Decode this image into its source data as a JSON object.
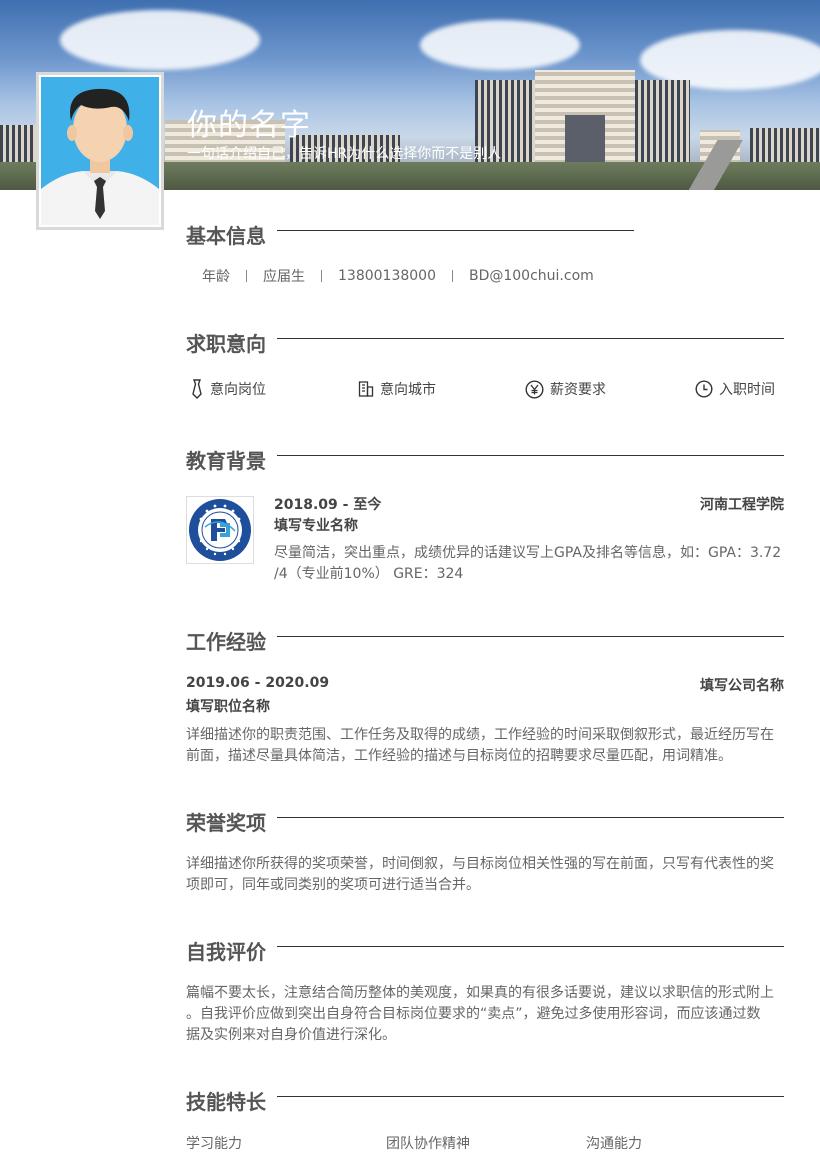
{
  "header": {
    "name": "你的名字",
    "tagline": "一句话介绍自己，告诉HR为什么选择你而不是别人"
  },
  "basic": {
    "title": "基本信息",
    "items": [
      "年龄",
      "应届生",
      "13800138000",
      "BD@100chui.com"
    ]
  },
  "intent": {
    "title": "求职意向",
    "items": [
      {
        "label": "意向岗位",
        "icon": "tie-icon"
      },
      {
        "label": "意向城市",
        "icon": "building-icon"
      },
      {
        "label": "薪资要求",
        "icon": "yen-icon"
      },
      {
        "label": "入职时间",
        "icon": "clock-icon"
      }
    ]
  },
  "education": {
    "title": "教育背景",
    "date": "2018.09 - 至今",
    "school": "河南工程学院",
    "major": "填写专业名称",
    "desc": "尽量简洁，突出重点，成绩优异的话建议写上GPA及排名等信息，如：GPA：3.72",
    "desc2": "/4（专业前10%） GRE：324"
  },
  "work": {
    "title": "工作经验",
    "date": "2019.06 - 2020.09",
    "company": "填写公司名称",
    "position": "填写职位名称",
    "desc1": "详细描述你的职责范围、工作任务及取得的成绩，工作经验的时间采取倒叙形式，最近经历写在",
    "desc2": "前面，描述尽量具体简洁，工作经验的描述与目标岗位的招聘要求尽量匹配，用词精准。"
  },
  "honors": {
    "title": "荣誉奖项",
    "desc1": "详细描述你所获得的奖项荣誉，时间倒叙，与目标岗位相关性强的写在前面，只写有代表性的奖",
    "desc2": "项即可，同年或同类别的奖项可进行适当合并。"
  },
  "self": {
    "title": "自我评价",
    "desc1": "篇幅不要太长，注意结合简历整体的美观度，如果真的有很多话要说，建议以求职信的形式附上",
    "desc2": "。自我评价应做到突出自身符合目标岗位要求的“卖点”，避免过多使用形容词，而应该通过数",
    "desc3": "据及实例来对自身价值进行深化。"
  },
  "skills": {
    "title": "技能特长",
    "items": [
      "学习能力",
      "团队协作精神",
      "沟通能力"
    ]
  },
  "colors": {
    "avatar_bg": "#3fb0e8",
    "logo_blue": "#1d4f9c"
  }
}
